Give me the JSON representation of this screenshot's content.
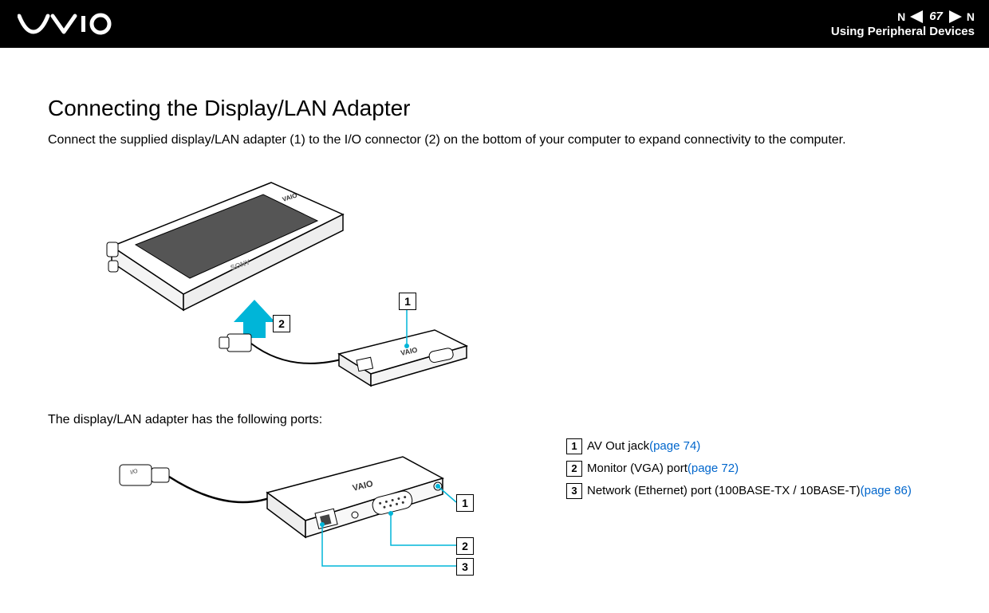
{
  "header": {
    "page_number": "67",
    "n_label": "N",
    "section": "Using Peripheral Devices"
  },
  "title": "Connecting the Display/LAN Adapter",
  "intro": "Connect the supplied display/LAN adapter (1) to the I/O connector (2) on the bottom of your computer to expand connectivity to the computer.",
  "figure1": {
    "callouts": {
      "1": "1",
      "2": "2"
    }
  },
  "sub": "The display/LAN adapter has the following ports:",
  "figure2": {
    "callouts": {
      "1": "1",
      "2": "2",
      "3": "3"
    }
  },
  "ports": [
    {
      "num": "1",
      "label": "AV Out jack ",
      "link": "(page 74)"
    },
    {
      "num": "2",
      "label": "Monitor (VGA) port ",
      "link": "(page 72)"
    },
    {
      "num": "3",
      "label": "Network (Ethernet) port (100BASE-TX / 10BASE-T) ",
      "link": "(page 86)"
    }
  ]
}
